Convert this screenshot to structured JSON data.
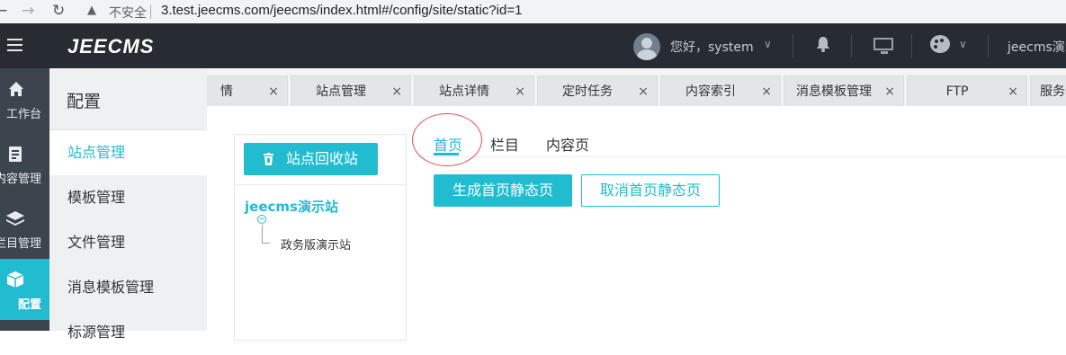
{
  "browser": {
    "back": "←",
    "forward": "→",
    "reload": "↻",
    "warning_icon": "▲",
    "security_text": "不安全",
    "url": "3.test.jeecms.com/jeecms/index.html#/config/site/static?id=1"
  },
  "header": {
    "logo": "JEECMS",
    "greeting": "您好，system",
    "chevron": "∨",
    "site_label": "jeecms演示站"
  },
  "rail": {
    "items": [
      {
        "label": "工作台",
        "icon": "home-icon"
      },
      {
        "label": "内容管理",
        "icon": "edit-icon"
      },
      {
        "label": "栏目管理",
        "icon": "layers-icon"
      },
      {
        "label": "配置",
        "icon": "cube-icon",
        "active": true
      }
    ]
  },
  "submenu": {
    "title": "配置",
    "items": [
      {
        "label": "站点管理",
        "active": true
      },
      {
        "label": "模板管理"
      },
      {
        "label": "文件管理"
      },
      {
        "label": "消息模板管理"
      },
      {
        "label": "标源管理"
      }
    ]
  },
  "tabs": {
    "prev_icon": "‹",
    "close": "×",
    "items": [
      {
        "label": "情"
      },
      {
        "label": "站点管理"
      },
      {
        "label": "站点详情"
      },
      {
        "label": "定时任务"
      },
      {
        "label": "内容索引"
      },
      {
        "label": "消息模板管理"
      },
      {
        "label": "FTP"
      },
      {
        "label": "服务器"
      }
    ]
  },
  "tree": {
    "recycle_button": "站点回收站",
    "root": "jeecms演示站",
    "child": "政务版演示站"
  },
  "static_tabs": {
    "items": [
      {
        "label": "首页",
        "active": true
      },
      {
        "label": "栏目"
      },
      {
        "label": "内容页"
      }
    ]
  },
  "actions": {
    "generate": "生成首页静态页",
    "cancel": "取消首页静态页"
  },
  "colors": {
    "accent": "#21bcd0",
    "header_bg": "#272c33",
    "rail_bg": "#3c444d",
    "annotation": "#e0504f"
  }
}
